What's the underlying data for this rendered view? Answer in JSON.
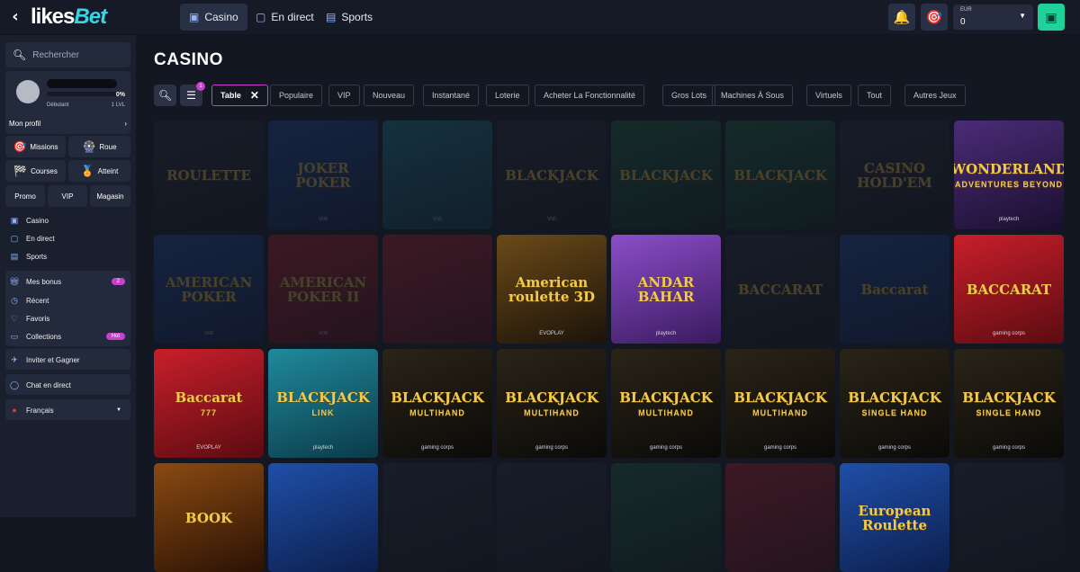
{
  "header": {
    "logo_part1": "likes",
    "logo_part2": "Bet",
    "nav": [
      {
        "label": "Casino",
        "icon": "casino-icon"
      },
      {
        "label": "En direct",
        "icon": "live-icon"
      },
      {
        "label": "Sports",
        "icon": "sports-icon"
      }
    ],
    "currency": "EUR",
    "balance": "0"
  },
  "sidebar": {
    "search_placeholder": "Rechercher",
    "profile": {
      "level_progress": "0%",
      "rank": "Débutant",
      "level": "1 LVL",
      "menu_label": "Mon profil"
    },
    "tiles": [
      "Missions",
      "Roue",
      "Courses",
      "Atteint"
    ],
    "small_tiles": [
      "Promo",
      "VIP",
      "Magasin"
    ],
    "nav_items": [
      "Casino",
      "En direct",
      "Sports"
    ],
    "account_items": [
      {
        "label": "Mes bonus",
        "badge": "2"
      },
      {
        "label": "Récent"
      },
      {
        "label": "Favoris"
      },
      {
        "label": "Collections",
        "badge": "Hot"
      }
    ],
    "invite": "Inviter et Gagner",
    "chat": "Chat en direct",
    "language": "Français"
  },
  "main": {
    "title": "CASINO",
    "filter_count": "1",
    "active_filter": "Table",
    "chips": [
      "Populaire",
      "VIP",
      "Nouveau",
      "Instantané",
      "Loterie",
      "Acheter La Fonctionnalité",
      "Gros Lots",
      "Machines À Sous",
      "Virtuels",
      "Tout",
      "Autres Jeux"
    ],
    "games": [
      {
        "title": "ROULETTE",
        "sub": "",
        "provider": "",
        "theme": "dark",
        "dim": true
      },
      {
        "title": "JOKER POKER",
        "sub": "",
        "provider": "Volt",
        "theme": "blue",
        "dim": true
      },
      {
        "title": "",
        "sub": "",
        "provider": "Volt",
        "theme": "teal",
        "dim": true
      },
      {
        "title": "BLACKJACK",
        "sub": "",
        "provider": "Volt",
        "theme": "dark",
        "dim": true
      },
      {
        "title": "BLACKJACK",
        "sub": "",
        "provider": "",
        "theme": "green",
        "dim": true
      },
      {
        "title": "BLACKJACK",
        "sub": "",
        "provider": "",
        "theme": "green",
        "dim": true
      },
      {
        "title": "CASINO HOLD'EM",
        "sub": "",
        "provider": "",
        "theme": "dark",
        "dim": true
      },
      {
        "title": "WONDERLAND",
        "sub": "ADVENTURES BEYOND",
        "provider": "playtech",
        "theme": "purple",
        "dim": false
      },
      {
        "title": "AMERICAN POKER",
        "sub": "",
        "provider": "Volt",
        "theme": "blue",
        "dim": true
      },
      {
        "title": "AMERICAN POKER II",
        "sub": "",
        "provider": "Volt",
        "theme": "red",
        "dim": true
      },
      {
        "title": "",
        "sub": "",
        "provider": "",
        "theme": "red",
        "dim": true
      },
      {
        "title": "American roulette 3D",
        "sub": "",
        "provider": "EVOPLAY",
        "theme": "gold",
        "dim": false
      },
      {
        "title": "ANDAR BAHAR",
        "sub": "",
        "provider": "playtech",
        "theme": "violet",
        "dim": false
      },
      {
        "title": "BACCARAT",
        "sub": "",
        "provider": "",
        "theme": "dark",
        "dim": true
      },
      {
        "title": "Baccarat",
        "sub": "",
        "provider": "",
        "theme": "blue",
        "dim": true
      },
      {
        "title": "BACCARAT",
        "sub": "",
        "provider": "gaming corps",
        "theme": "red",
        "dim": false
      },
      {
        "title": "Baccarat",
        "sub": "777",
        "provider": "EVOPLAY",
        "theme": "red",
        "dim": false
      },
      {
        "title": "BLACKJACK",
        "sub": "LINK",
        "provider": "playtech",
        "theme": "teal",
        "dim": false
      },
      {
        "title": "BLACKJACK",
        "sub": "MULTIHAND",
        "provider": "gaming corps",
        "theme": "black",
        "dim": false
      },
      {
        "title": "BLACKJACK",
        "sub": "MULTIHAND",
        "provider": "gaming corps",
        "theme": "black",
        "dim": false
      },
      {
        "title": "BLACKJACK",
        "sub": "MULTIHAND",
        "provider": "gaming corps",
        "theme": "black",
        "dim": false
      },
      {
        "title": "BLACKJACK",
        "sub": "MULTIHAND",
        "provider": "gaming corps",
        "theme": "black",
        "dim": false
      },
      {
        "title": "BLACKJACK",
        "sub": "SINGLE HAND",
        "provider": "gaming corps",
        "theme": "black",
        "dim": false
      },
      {
        "title": "BLACKJACK",
        "sub": "SINGLE HAND",
        "provider": "gaming corps",
        "theme": "black",
        "dim": false
      },
      {
        "title": "BOOK",
        "sub": "",
        "provider": "",
        "theme": "brown",
        "dim": false
      },
      {
        "title": "",
        "sub": "",
        "provider": "",
        "theme": "blue",
        "dim": false
      },
      {
        "title": "",
        "sub": "",
        "provider": "",
        "theme": "dark",
        "dim": true
      },
      {
        "title": "",
        "sub": "",
        "provider": "",
        "theme": "dark",
        "dim": true
      },
      {
        "title": "",
        "sub": "",
        "provider": "",
        "theme": "green",
        "dim": true
      },
      {
        "title": "",
        "sub": "",
        "provider": "",
        "theme": "red",
        "dim": true
      },
      {
        "title": "European Roulette",
        "sub": "",
        "provider": "",
        "theme": "blue",
        "dim": false
      },
      {
        "title": "",
        "sub": "",
        "provider": "",
        "theme": "dark",
        "dim": true
      }
    ]
  },
  "colors": {
    "accent": "#c93fd0",
    "wallet": "#1ed29a",
    "sidebar_bg": "#1a1f2d",
    "page_bg": "#131722"
  }
}
